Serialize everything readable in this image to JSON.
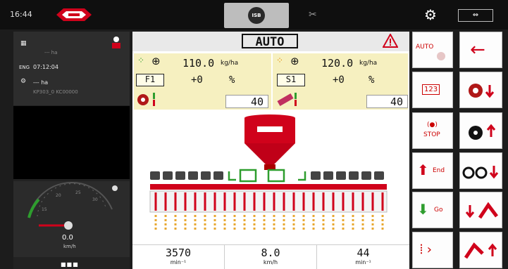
{
  "topbar": {
    "time": "16:44",
    "isobus_label": "ISB",
    "screen_toggle": "⇔"
  },
  "left_panel": {
    "implement_hours": "--- ha",
    "engine_label": "ENG",
    "engine_time": "07:12:04",
    "worked_area": "--- ha",
    "device_id": "KP303_0 KC00000",
    "speed_value": "0.0",
    "speed_unit": "km/h",
    "menu_dots": "■■■"
  },
  "center": {
    "mode": "AUTO",
    "product1": {
      "rate": "110.0",
      "unit": "kg/ha",
      "section": "F1",
      "delta": "+0",
      "pct": "%",
      "setpoint": "40"
    },
    "product2": {
      "rate": "120.0",
      "unit": "kg/ha",
      "section": "S1",
      "delta": "+0",
      "pct": "%",
      "setpoint": "40"
    },
    "stats": [
      {
        "value": "3570",
        "unit": "min⁻¹"
      },
      {
        "value": "8.0",
        "unit": "km/h"
      },
      {
        "value": "44",
        "unit": "min⁻¹"
      }
    ]
  },
  "right_buttons": {
    "auto": "AUTO",
    "stop": "STOP",
    "end": "End",
    "go": "Go",
    "numeric": "123"
  },
  "colors": {
    "accent_red": "#d0021b",
    "green": "#2e9d2e",
    "panel_bg": "#f6f0c0"
  }
}
